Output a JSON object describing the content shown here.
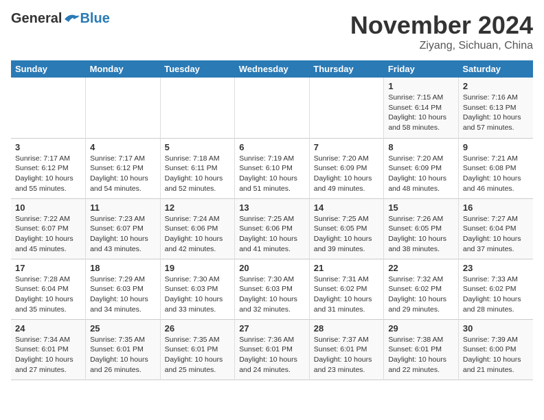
{
  "header": {
    "logo_general": "General",
    "logo_blue": "Blue",
    "month": "November 2024",
    "location": "Ziyang, Sichuan, China"
  },
  "weekdays": [
    "Sunday",
    "Monday",
    "Tuesday",
    "Wednesday",
    "Thursday",
    "Friday",
    "Saturday"
  ],
  "weeks": [
    [
      {
        "day": "",
        "info": ""
      },
      {
        "day": "",
        "info": ""
      },
      {
        "day": "",
        "info": ""
      },
      {
        "day": "",
        "info": ""
      },
      {
        "day": "",
        "info": ""
      },
      {
        "day": "1",
        "info": "Sunrise: 7:15 AM\nSunset: 6:14 PM\nDaylight: 10 hours\nand 58 minutes."
      },
      {
        "day": "2",
        "info": "Sunrise: 7:16 AM\nSunset: 6:13 PM\nDaylight: 10 hours\nand 57 minutes."
      }
    ],
    [
      {
        "day": "3",
        "info": "Sunrise: 7:17 AM\nSunset: 6:12 PM\nDaylight: 10 hours\nand 55 minutes."
      },
      {
        "day": "4",
        "info": "Sunrise: 7:17 AM\nSunset: 6:12 PM\nDaylight: 10 hours\nand 54 minutes."
      },
      {
        "day": "5",
        "info": "Sunrise: 7:18 AM\nSunset: 6:11 PM\nDaylight: 10 hours\nand 52 minutes."
      },
      {
        "day": "6",
        "info": "Sunrise: 7:19 AM\nSunset: 6:10 PM\nDaylight: 10 hours\nand 51 minutes."
      },
      {
        "day": "7",
        "info": "Sunrise: 7:20 AM\nSunset: 6:09 PM\nDaylight: 10 hours\nand 49 minutes."
      },
      {
        "day": "8",
        "info": "Sunrise: 7:20 AM\nSunset: 6:09 PM\nDaylight: 10 hours\nand 48 minutes."
      },
      {
        "day": "9",
        "info": "Sunrise: 7:21 AM\nSunset: 6:08 PM\nDaylight: 10 hours\nand 46 minutes."
      }
    ],
    [
      {
        "day": "10",
        "info": "Sunrise: 7:22 AM\nSunset: 6:07 PM\nDaylight: 10 hours\nand 45 minutes."
      },
      {
        "day": "11",
        "info": "Sunrise: 7:23 AM\nSunset: 6:07 PM\nDaylight: 10 hours\nand 43 minutes."
      },
      {
        "day": "12",
        "info": "Sunrise: 7:24 AM\nSunset: 6:06 PM\nDaylight: 10 hours\nand 42 minutes."
      },
      {
        "day": "13",
        "info": "Sunrise: 7:25 AM\nSunset: 6:06 PM\nDaylight: 10 hours\nand 41 minutes."
      },
      {
        "day": "14",
        "info": "Sunrise: 7:25 AM\nSunset: 6:05 PM\nDaylight: 10 hours\nand 39 minutes."
      },
      {
        "day": "15",
        "info": "Sunrise: 7:26 AM\nSunset: 6:05 PM\nDaylight: 10 hours\nand 38 minutes."
      },
      {
        "day": "16",
        "info": "Sunrise: 7:27 AM\nSunset: 6:04 PM\nDaylight: 10 hours\nand 37 minutes."
      }
    ],
    [
      {
        "day": "17",
        "info": "Sunrise: 7:28 AM\nSunset: 6:04 PM\nDaylight: 10 hours\nand 35 minutes."
      },
      {
        "day": "18",
        "info": "Sunrise: 7:29 AM\nSunset: 6:03 PM\nDaylight: 10 hours\nand 34 minutes."
      },
      {
        "day": "19",
        "info": "Sunrise: 7:30 AM\nSunset: 6:03 PM\nDaylight: 10 hours\nand 33 minutes."
      },
      {
        "day": "20",
        "info": "Sunrise: 7:30 AM\nSunset: 6:03 PM\nDaylight: 10 hours\nand 32 minutes."
      },
      {
        "day": "21",
        "info": "Sunrise: 7:31 AM\nSunset: 6:02 PM\nDaylight: 10 hours\nand 31 minutes."
      },
      {
        "day": "22",
        "info": "Sunrise: 7:32 AM\nSunset: 6:02 PM\nDaylight: 10 hours\nand 29 minutes."
      },
      {
        "day": "23",
        "info": "Sunrise: 7:33 AM\nSunset: 6:02 PM\nDaylight: 10 hours\nand 28 minutes."
      }
    ],
    [
      {
        "day": "24",
        "info": "Sunrise: 7:34 AM\nSunset: 6:01 PM\nDaylight: 10 hours\nand 27 minutes."
      },
      {
        "day": "25",
        "info": "Sunrise: 7:35 AM\nSunset: 6:01 PM\nDaylight: 10 hours\nand 26 minutes."
      },
      {
        "day": "26",
        "info": "Sunrise: 7:35 AM\nSunset: 6:01 PM\nDaylight: 10 hours\nand 25 minutes."
      },
      {
        "day": "27",
        "info": "Sunrise: 7:36 AM\nSunset: 6:01 PM\nDaylight: 10 hours\nand 24 minutes."
      },
      {
        "day": "28",
        "info": "Sunrise: 7:37 AM\nSunset: 6:01 PM\nDaylight: 10 hours\nand 23 minutes."
      },
      {
        "day": "29",
        "info": "Sunrise: 7:38 AM\nSunset: 6:01 PM\nDaylight: 10 hours\nand 22 minutes."
      },
      {
        "day": "30",
        "info": "Sunrise: 7:39 AM\nSunset: 6:00 PM\nDaylight: 10 hours\nand 21 minutes."
      }
    ]
  ]
}
